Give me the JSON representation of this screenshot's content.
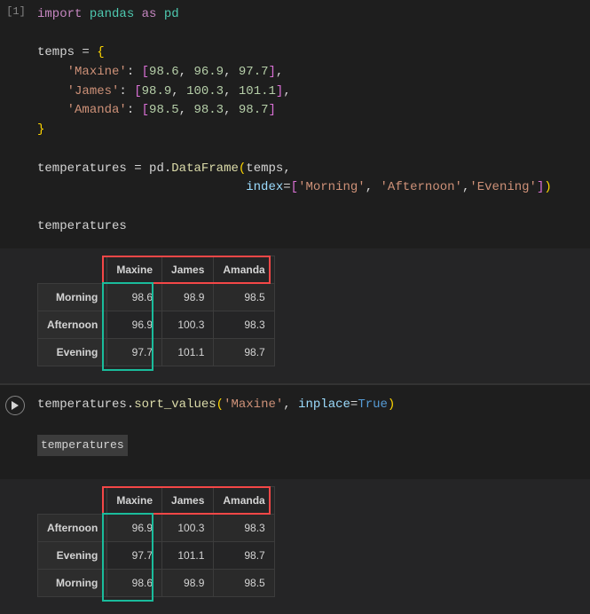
{
  "cells": {
    "cell1": {
      "label": "[1]",
      "code": {
        "l1": {
          "kw1": "import",
          "lib": "pandas",
          "kw2": "as",
          "alias": "pd"
        },
        "l3": {
          "var": "temps",
          "eq": "="
        },
        "l4": {
          "key": "'Maxine'",
          "v1": "98.6",
          "v2": "96.9",
          "v3": "97.7"
        },
        "l5": {
          "key": "'James'",
          "v1": "98.9",
          "v2": "100.3",
          "v3": "101.1"
        },
        "l6": {
          "key": "'Amanda'",
          "v1": "98.5",
          "v2": "98.3",
          "v3": "98.7"
        },
        "l9": {
          "var": "temperatures",
          "eq": "=",
          "mod": "pd",
          "fn": "DataFrame",
          "arg": "temps"
        },
        "l10": {
          "param": "index",
          "v1": "'Morning'",
          "v2": "'Afternoon'",
          "v3": "'Evening'"
        },
        "l12": {
          "stmt": "temperatures"
        }
      },
      "output": {
        "columns": [
          "Maxine",
          "James",
          "Amanda"
        ],
        "rows": [
          {
            "idx": "Morning",
            "c": [
              "98.6",
              "98.9",
              "98.5"
            ]
          },
          {
            "idx": "Afternoon",
            "c": [
              "96.9",
              "100.3",
              "98.3"
            ]
          },
          {
            "idx": "Evening",
            "c": [
              "97.7",
              "101.1",
              "98.7"
            ]
          }
        ]
      }
    },
    "cell2": {
      "code": {
        "l1": {
          "var": "temperatures",
          "fn": "sort_values",
          "arg": "'Maxine'",
          "param": "inplace",
          "val": "True"
        },
        "l3": {
          "stmt": "temperatures"
        }
      },
      "output": {
        "columns": [
          "Maxine",
          "James",
          "Amanda"
        ],
        "rows": [
          {
            "idx": "Afternoon",
            "c": [
              "96.9",
              "100.3",
              "98.3"
            ]
          },
          {
            "idx": "Evening",
            "c": [
              "97.7",
              "101.1",
              "98.7"
            ]
          },
          {
            "idx": "Morning",
            "c": [
              "98.6",
              "98.9",
              "98.5"
            ]
          }
        ]
      }
    }
  },
  "chart_data": [
    {
      "type": "table",
      "title": "temperatures",
      "columns": [
        "",
        "Maxine",
        "James",
        "Amanda"
      ],
      "rows": [
        [
          "Morning",
          98.6,
          98.9,
          98.5
        ],
        [
          "Afternoon",
          96.9,
          100.3,
          98.3
        ],
        [
          "Evening",
          97.7,
          101.1,
          98.7
        ]
      ]
    },
    {
      "type": "table",
      "title": "temperatures (sorted by Maxine)",
      "columns": [
        "",
        "Maxine",
        "James",
        "Amanda"
      ],
      "rows": [
        [
          "Afternoon",
          96.9,
          100.3,
          98.3
        ],
        [
          "Evening",
          97.7,
          101.1,
          98.7
        ],
        [
          "Morning",
          98.6,
          98.9,
          98.5
        ]
      ]
    }
  ],
  "colors": {
    "red": "#f44747",
    "green": "#1abc9c"
  }
}
